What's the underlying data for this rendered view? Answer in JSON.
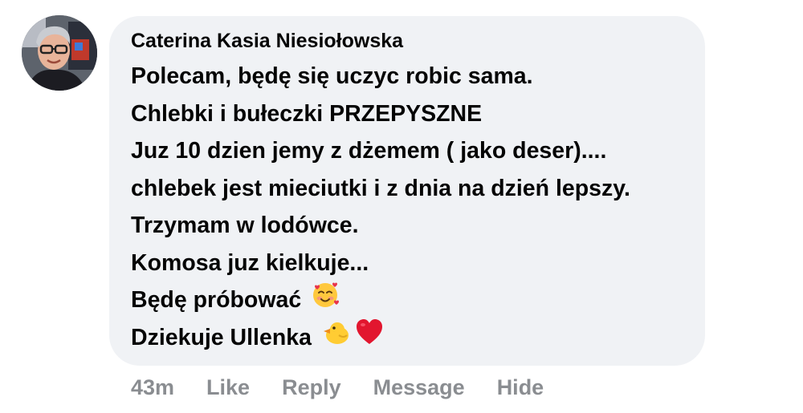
{
  "comment": {
    "author": "Caterina Kasia Niesiołowska",
    "lines": [
      "Polecam, będę się uczyc robic sama.",
      "Chlebki i bułeczki PRZEPYSZNE",
      "Juz 10 dzien jemy z dżemem ( jako deser)....",
      "chlebek jest mieciutki i z dnia na dzień lepszy.",
      "Trzymam w lodówce.",
      "Komosa juz kielkuje...",
      "Będę próbować",
      "Dziekuje Ullenka"
    ],
    "emoji": {
      "line7": "smiling-face-with-hearts",
      "line8": [
        "baby-chick",
        "red-heart"
      ]
    }
  },
  "actions": {
    "timestamp": "43m",
    "like": "Like",
    "reply": "Reply",
    "message": "Message",
    "hide": "Hide"
  },
  "colors": {
    "bubble": "#f0f2f5",
    "text": "#050505",
    "muted": "#8a8d91"
  }
}
